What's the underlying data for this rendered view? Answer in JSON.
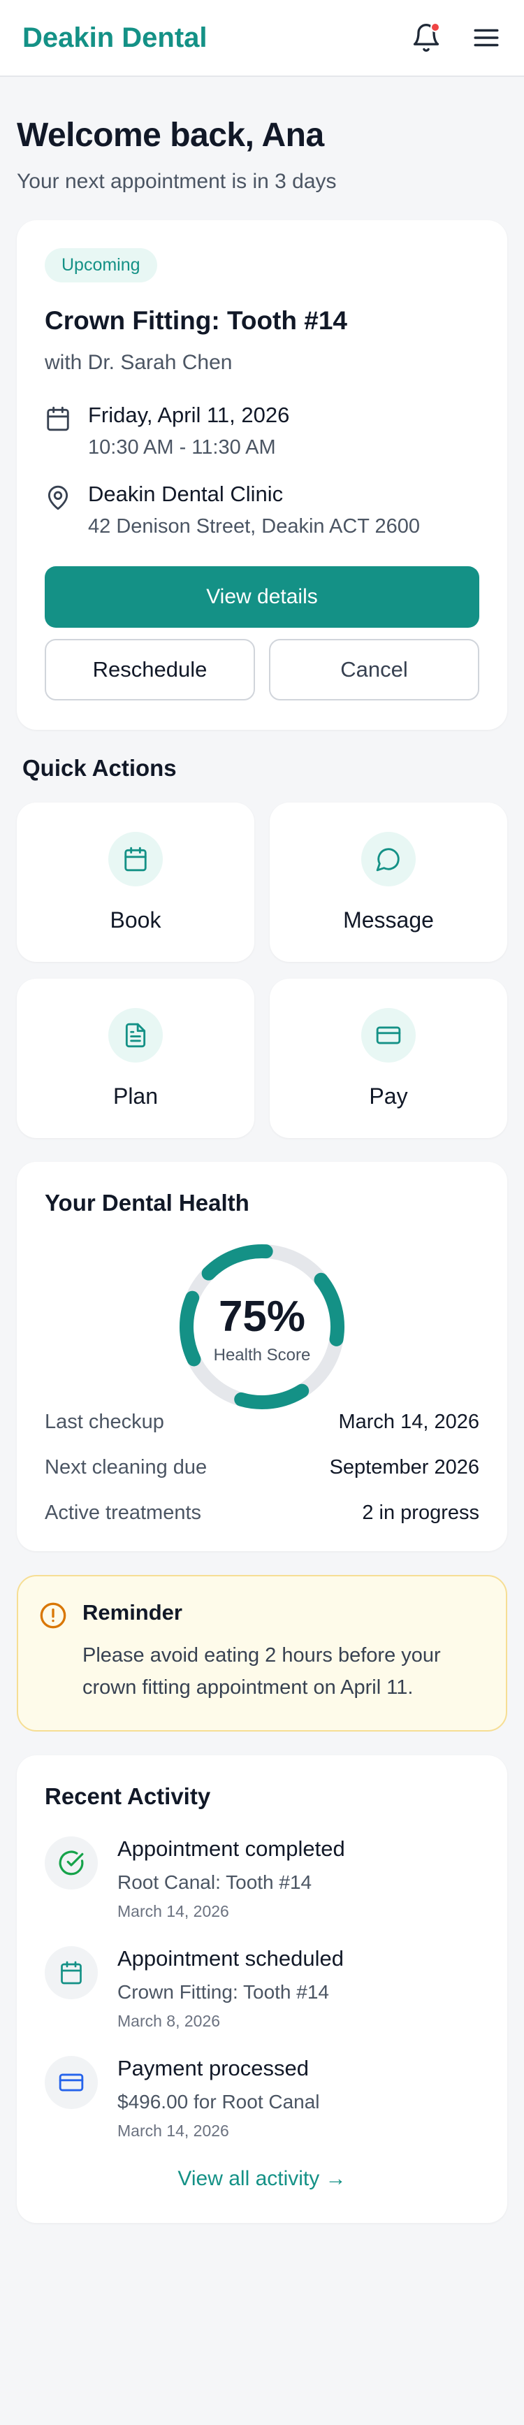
{
  "header": {
    "brand": "Deakin Dental",
    "icons": [
      "bell-icon",
      "menu-icon"
    ],
    "notification_dot": true
  },
  "welcome": {
    "title": "Welcome back, Ana",
    "subtitle": "Your next appointment is in 3 days"
  },
  "appointment": {
    "badge": "Upcoming",
    "title": "Crown Fitting: Tooth #14",
    "doctor": "with Dr. Sarah Chen",
    "date": "Friday, April 11, 2026",
    "time": "10:30 AM - 11:30 AM",
    "location": "Deakin Dental Clinic",
    "address": "42 Denison Street, Deakin ACT 2600",
    "primary_button": "View details",
    "reschedule_button": "Reschedule",
    "cancel_button": "Cancel"
  },
  "quick_actions": {
    "title": "Quick Actions",
    "items": [
      {
        "label": "Book",
        "icon": "calendar-icon"
      },
      {
        "label": "Message",
        "icon": "chat-icon"
      },
      {
        "label": "Plan",
        "icon": "document-icon"
      },
      {
        "label": "Pay",
        "icon": "credit-card-icon"
      }
    ]
  },
  "dental_health": {
    "title": "Your Dental Health",
    "score_value": "75%",
    "score_label": "Health Score",
    "score_fraction": 0.75,
    "stats": [
      {
        "label": "Last checkup",
        "value": "March 14, 2026"
      },
      {
        "label": "Next cleaning due",
        "value": "September 2026"
      },
      {
        "label": "Active treatments",
        "value": "2 in progress"
      }
    ]
  },
  "reminder": {
    "title": "Reminder",
    "body": "Please avoid eating 2 hours before your crown fitting appointment on April 11."
  },
  "recent_activity": {
    "title": "Recent Activity",
    "items": [
      {
        "title": "Appointment completed",
        "subtitle": "Root Canal: Tooth #14",
        "date": "March 14, 2026",
        "icon": "check-circle-icon"
      },
      {
        "title": "Appointment scheduled",
        "subtitle": "Crown Fitting: Tooth #14",
        "date": "March 8, 2026",
        "icon": "calendar-icon"
      },
      {
        "title": "Payment processed",
        "subtitle": "$496.00 for Root Canal",
        "date": "March 14, 2026",
        "icon": "credit-card-icon"
      }
    ],
    "view_all": "View all activity →"
  },
  "colors": {
    "brand": "#149186",
    "brand_tint": "#E8F7F4",
    "reminder_bg": "#FEFBEA",
    "reminder_border": "#F6DE94",
    "warning": "#D97706",
    "success": "#16A34A",
    "payment": "#2563EB",
    "notification": "#EF4444"
  }
}
